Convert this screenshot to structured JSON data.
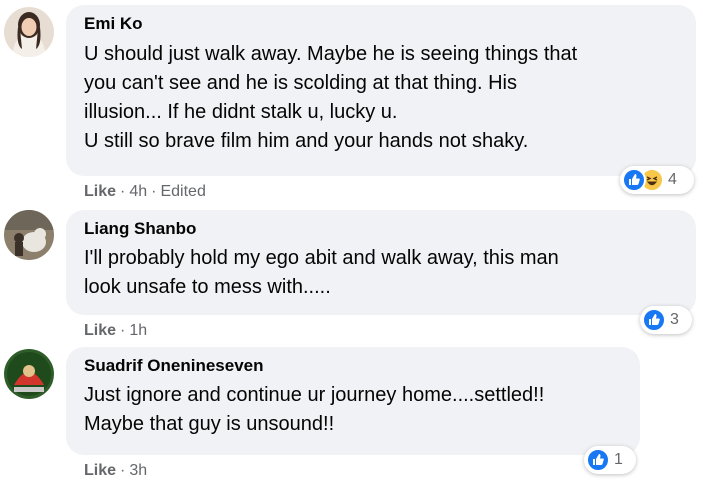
{
  "colors": {
    "bubble_bg": "#f0f2f5",
    "meta_text": "#65676b",
    "like_blue": "#1877f2",
    "haha_yellow": "#f7c74a"
  },
  "comments": [
    {
      "author": "Emi Ko",
      "lines": [
        "U should just walk away. Maybe he is seeing things that",
        "you can't see and he is scolding at that thing. His",
        "illusion... If he didnt stalk u, lucky u.",
        "U still so brave film him and your hands not shaky."
      ],
      "like_label": "Like",
      "time": "4h",
      "edited": "Edited",
      "reactions": [
        "like-icon",
        "haha-icon"
      ],
      "reaction_count": "4"
    },
    {
      "author": "Liang Shanbo",
      "lines": [
        "I'll probably hold my ego abit and walk away, this man",
        "look unsafe to mess with....."
      ],
      "like_label": "Like",
      "time": "1h",
      "reactions": [
        "like-icon"
      ],
      "reaction_count": "3"
    },
    {
      "author": "Suadrif Onenineseven",
      "lines": [
        "Just ignore and continue ur journey home....settled!!",
        "Maybe that guy is unsound!!"
      ],
      "like_label": "Like",
      "time": "3h",
      "reactions": [
        "like-icon"
      ],
      "reaction_count": "1"
    }
  ]
}
